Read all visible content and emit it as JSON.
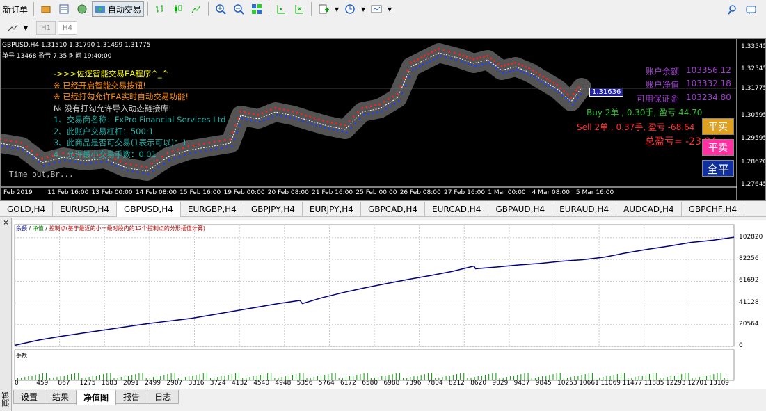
{
  "toolbar": {
    "new_order_label": "新订单",
    "auto_trade_label": "自动交易",
    "timeframe_buttons": [
      "H1",
      "H4"
    ]
  },
  "chart": {
    "header_line": "GBPUSD,H4  1.31510 1.31790 1.31499 1.31775",
    "info_line": "单号 13468  盈亏 7.35  时间 19:40:00",
    "current_price": "1.31636",
    "price_ticks": [
      "1.33545",
      "1.32545",
      "1.31775",
      "1.30595",
      "1.29595",
      "1.28620",
      "1.27645"
    ],
    "time_ticks": [
      "Feb 2019",
      "11 Feb 16:00",
      "13 Feb 00:00",
      "14 Feb 08:00",
      "15 Feb 16:00",
      "19 Feb 00:00",
      "20 Feb 08:00",
      "21 Feb 16:00",
      "25 Feb 00:00",
      "26 Feb 08:00",
      "27 Feb 16:00",
      "1 Mar 00:00",
      "4 Mar 08:00",
      "5 Mar 16:00"
    ],
    "ea_lines": [
      {
        "text": "->>>佐逻智能交易EA程序^_^",
        "color": "#ffff00"
      },
      {
        "text": "※ 已经开启智能交易按钮!",
        "color": "#ff8c00"
      },
      {
        "text": "※ 已经打勾允许EA实时自动交易功能!",
        "color": "#ff8c00"
      },
      {
        "text": "№ 没有打勾允许导入动态链接库!",
        "color": "#d0d0d0"
      },
      {
        "text": "1、交易商名称：FxPro Financial Services Ltd",
        "color": "#20b2aa"
      },
      {
        "text": "2、此账户交易杠杆：500:1",
        "color": "#20b2aa"
      },
      {
        "text": "3、此商品是否可交易(1表示可以)：1",
        "color": "#20b2aa"
      },
      {
        "text": "4、允许最小交易手数：0.01",
        "color": "#20b2aa"
      }
    ],
    "timeout_text": "Time out,Br...",
    "account": {
      "balance_label": "账户余额",
      "balance_value": "103356.12",
      "equity_label": "账户净值",
      "equity_value": "103332.18",
      "margin_label": "可用保证金",
      "margin_value": "103234.80"
    },
    "buy_summary": "Buy  2单 , 0.30手,  盈亏 44.70",
    "sell_summary": "Sell  2单 , 0.37手,  盈亏 -68.64",
    "total_pl": "总盈亏= -23.94",
    "buttons": {
      "buy_close": "平买",
      "sell_close": "平卖",
      "all_close": "全平"
    }
  },
  "symbol_tabs": [
    "GOLD,H4",
    "EURUSD,H4",
    "GBPUSD,H4",
    "EURGBP,H4",
    "GBPJPY,H4",
    "EURJPY,H4",
    "GBPCAD,H4",
    "EURCAD,H4",
    "GBPAUD,H4",
    "EURAUD,H4",
    "AUDCAD,H4",
    "GBPCHF,H4"
  ],
  "tester": {
    "side_label": "测试",
    "legend": {
      "balance": "余额",
      "equity": "净值",
      "control": "控制点(基于最近的小一级时段内的12个控制点的分形插值计算)"
    },
    "lots_label": "手数",
    "y_ticks": [
      "102820",
      "82256",
      "61692",
      "41128",
      "20564",
      "0"
    ],
    "x_ticks": [
      "0",
      "459",
      "867",
      "1275",
      "1683",
      "2091",
      "2499",
      "2907",
      "3316",
      "3724",
      "4132",
      "4540",
      "4948",
      "5356",
      "5764",
      "6172",
      "6580",
      "6988",
      "7396",
      "7804",
      "8212",
      "8620",
      "9029",
      "9437",
      "9845",
      "10253",
      "10661",
      "11069",
      "11477",
      "11885",
      "12293",
      "12701",
      "13109"
    ],
    "tabs": [
      "设置",
      "结果",
      "净值图",
      "报告",
      "日志"
    ],
    "active_tab": "净值图"
  },
  "chart_data": {
    "type": "line",
    "x": [
      0,
      459,
      867,
      1275,
      1683,
      2091,
      2499,
      2907,
      3316,
      3724,
      4132,
      4540,
      4948,
      5356,
      5400,
      5764,
      6172,
      6580,
      6988,
      7396,
      7804,
      8212,
      8620,
      8650,
      9029,
      9437,
      9845,
      10253,
      10661,
      11069,
      11477,
      11885,
      12293,
      12701,
      13109,
      13500
    ],
    "series": [
      {
        "name": "余额",
        "values": [
          1000,
          6000,
          9500,
          12500,
          15500,
          18500,
          21500,
          24000,
          26500,
          30000,
          33500,
          37000,
          40500,
          43500,
          40500,
          46000,
          51000,
          55500,
          59500,
          63500,
          67000,
          71000,
          76000,
          73500,
          75000,
          77000,
          78500,
          80500,
          82000,
          84500,
          88500,
          92000,
          95000,
          98500,
          100500,
          103332
        ]
      }
    ],
    "ylim": [
      0,
      110000
    ],
    "grid": true
  }
}
